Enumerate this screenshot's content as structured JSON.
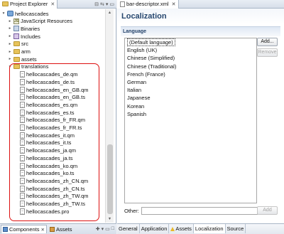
{
  "project_explorer": {
    "tab_title": "Project Explorer",
    "tree": [
      {
        "label": "hellocascades",
        "icon": "project-icon",
        "twisty": "expanded",
        "depth": 0
      },
      {
        "label": "JavaScript Resources",
        "icon": "javascript-icon",
        "twisty": "collapsed",
        "depth": 1
      },
      {
        "label": "Binaries",
        "icon": "binaries-icon",
        "twisty": "collapsed",
        "depth": 1
      },
      {
        "label": "Includes",
        "icon": "includes-icon",
        "twisty": "collapsed",
        "depth": 1
      },
      {
        "label": "src",
        "icon": "folder-icon",
        "twisty": "collapsed",
        "depth": 1
      },
      {
        "label": "arm",
        "icon": "folder-icon",
        "twisty": "collapsed",
        "depth": 1
      },
      {
        "label": "assets",
        "icon": "folder-icon",
        "twisty": "collapsed",
        "depth": 1
      },
      {
        "label": "translations",
        "icon": "folder-icon",
        "twisty": "expanded",
        "depth": 1
      },
      {
        "label": "hellocascades_de.qm",
        "icon": "file-icon",
        "depth": 2
      },
      {
        "label": "hellocascades_de.ts",
        "icon": "file-icon",
        "depth": 2
      },
      {
        "label": "hellocascades_en_GB.qm",
        "icon": "file-icon",
        "depth": 2
      },
      {
        "label": "hellocascades_en_GB.ts",
        "icon": "file-icon",
        "depth": 2
      },
      {
        "label": "hellocascades_es.qm",
        "icon": "file-icon",
        "depth": 2
      },
      {
        "label": "hellocascades_es.ts",
        "icon": "file-icon",
        "depth": 2
      },
      {
        "label": "hellocascades_fr_FR.qm",
        "icon": "file-icon",
        "depth": 2
      },
      {
        "label": "hellocascades_fr_FR.ts",
        "icon": "file-icon",
        "depth": 2
      },
      {
        "label": "hellocascades_it.qm",
        "icon": "file-icon",
        "depth": 2
      },
      {
        "label": "hellocascades_it.ts",
        "icon": "file-icon",
        "depth": 2
      },
      {
        "label": "hellocascades_ja.qm",
        "icon": "file-icon",
        "depth": 2
      },
      {
        "label": "hellocascades_ja.ts",
        "icon": "file-icon",
        "depth": 2
      },
      {
        "label": "hellocascades_ko.qm",
        "icon": "file-icon",
        "depth": 2
      },
      {
        "label": "hellocascades_ko.ts",
        "icon": "file-icon",
        "depth": 2
      },
      {
        "label": "hellocascades_zh_CN.qm",
        "icon": "file-icon",
        "depth": 2
      },
      {
        "label": "hellocascades_zh_CN.ts",
        "icon": "file-icon",
        "depth": 2
      },
      {
        "label": "hellocascades_zh_TW.qm",
        "icon": "file-icon",
        "depth": 2
      },
      {
        "label": "hellocascades_zh_TW.ts",
        "icon": "file-icon",
        "depth": 2
      },
      {
        "label": "hellocascades.pro",
        "icon": "file-icon",
        "depth": 2
      }
    ]
  },
  "bottom_left_tabs": {
    "components": "Components",
    "assets": "Assets"
  },
  "editor": {
    "tab_title": "bar-descriptor.xml",
    "form_title": "Localization",
    "section_title": "Language",
    "languages": [
      "(Default language)",
      "English (UK)",
      "Chinese (Simplified)",
      "Chinese (Traditional)",
      "French (France)",
      "German",
      "Italian",
      "Japanese",
      "Korean",
      "Spanish"
    ],
    "selected_language_index": 0,
    "add_button": "Add...",
    "remove_button": "Remove",
    "other_label": "Other:",
    "other_value": "",
    "other_add_button": "Add",
    "bottom_tabs": [
      "General",
      "Application",
      "Assets",
      "Localization",
      "Source"
    ],
    "active_bottom_tab": "Localization"
  },
  "colors": {
    "highlight_box": "#dd1111",
    "header_text": "#25466e"
  }
}
